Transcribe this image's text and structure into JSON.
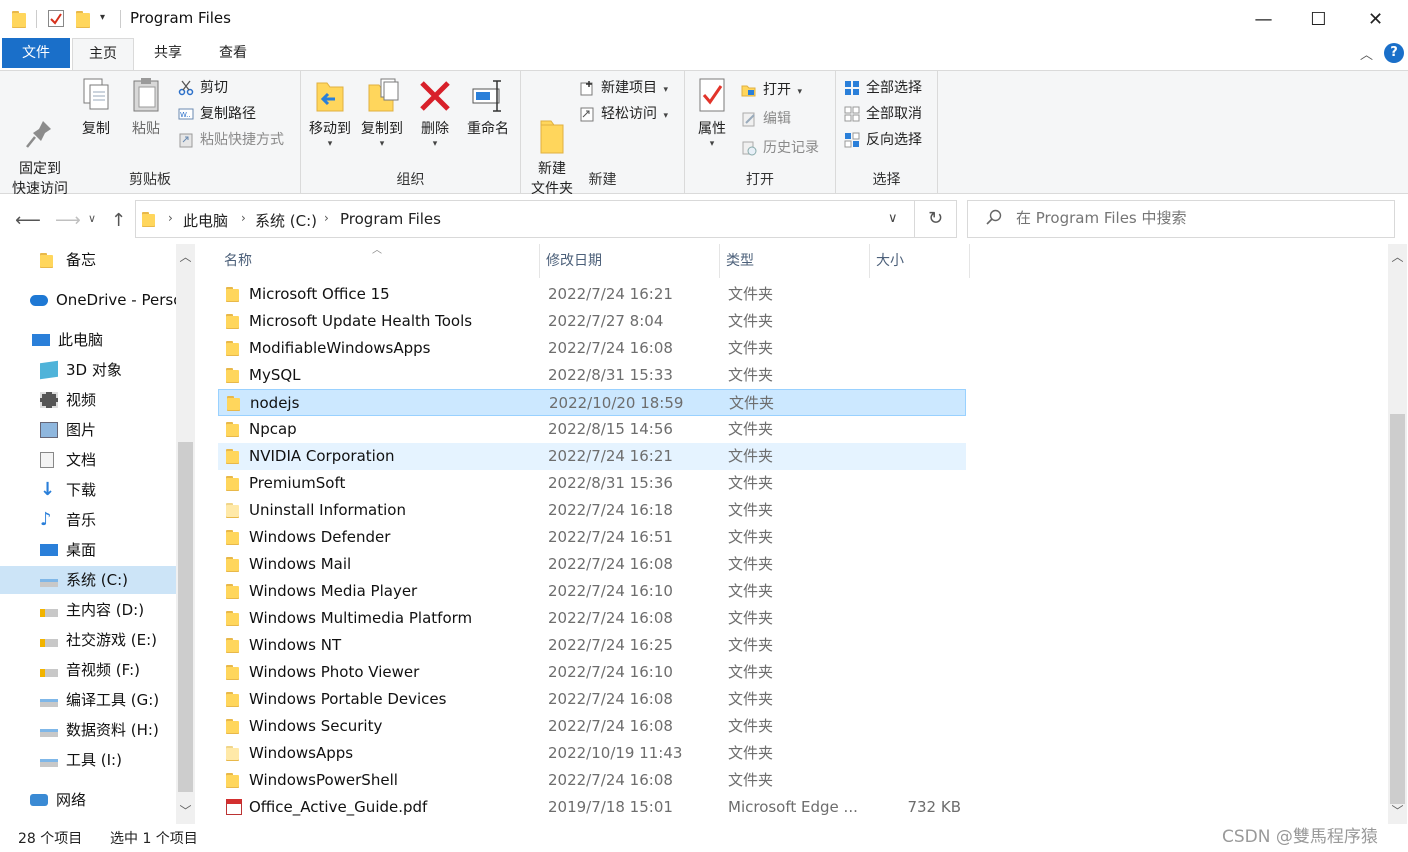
{
  "window": {
    "title": "Program Files",
    "controls": {
      "minimize": "—",
      "maximize": "☐",
      "close": "✕"
    }
  },
  "ribbon_tabs": [
    "文件",
    "主页",
    "共享",
    "查看"
  ],
  "ribbon": {
    "clipboard": {
      "label": "剪贴板",
      "pin": "固定到\n快速访问",
      "copy": "复制",
      "paste": "粘贴",
      "cut": "剪切",
      "copy_path": "复制路径",
      "paste_shortcut": "粘贴快捷方式"
    },
    "organize": {
      "label": "组织",
      "move_to": "移动到",
      "copy_to": "复制到",
      "delete": "删除",
      "rename": "重命名"
    },
    "new": {
      "label": "新建",
      "new_folder": "新建\n文件夹",
      "new_item": "新建项目",
      "easy_access": "轻松访问"
    },
    "open": {
      "label": "打开",
      "properties": "属性",
      "open": "打开",
      "edit": "编辑",
      "history": "历史记录"
    },
    "select": {
      "label": "选择",
      "select_all": "全部选择",
      "select_none": "全部取消",
      "invert": "反向选择"
    }
  },
  "address": {
    "crumbs": [
      "此电脑",
      "系统 (C:)",
      "Program Files"
    ],
    "search_placeholder": "在 Program Files 中搜索"
  },
  "nav_items": [
    {
      "label": "备忘",
      "icon": "folder-icon"
    },
    {
      "label": "OneDrive - Personal",
      "icon": "onedrive-icon"
    },
    {
      "label": "此电脑",
      "icon": "computer-icon"
    },
    {
      "label": "3D 对象",
      "icon": "3d-objects-icon"
    },
    {
      "label": "视频",
      "icon": "video-icon"
    },
    {
      "label": "图片",
      "icon": "pictures-icon"
    },
    {
      "label": "文档",
      "icon": "documents-icon"
    },
    {
      "label": "下载",
      "icon": "download-icon"
    },
    {
      "label": "音乐",
      "icon": "music-icon"
    },
    {
      "label": "桌面",
      "icon": "desktop-icon"
    },
    {
      "label": "系统 (C:)",
      "icon": "drive-icon",
      "selected": true
    },
    {
      "label": "主内容 (D:)",
      "icon": "drive-warning-icon"
    },
    {
      "label": "社交游戏 (E:)",
      "icon": "drive-warning-icon"
    },
    {
      "label": "音视频 (F:)",
      "icon": "drive-warning-icon"
    },
    {
      "label": "编译工具 (G:)",
      "icon": "drive-icon"
    },
    {
      "label": "数据资料 (H:)",
      "icon": "drive-icon"
    },
    {
      "label": "工具 (I:)",
      "icon": "drive-icon"
    },
    {
      "label": "网络",
      "icon": "network-icon"
    }
  ],
  "columns": {
    "name": "名称",
    "date": "修改日期",
    "type": "类型",
    "size": "大小"
  },
  "files": [
    {
      "name": "Microsoft Office 15",
      "date": "2022/7/24 16:21",
      "type": "文件夹",
      "size": ""
    },
    {
      "name": "Microsoft Update Health Tools",
      "date": "2022/7/27 8:04",
      "type": "文件夹",
      "size": ""
    },
    {
      "name": "ModifiableWindowsApps",
      "date": "2022/7/24 16:08",
      "type": "文件夹",
      "size": ""
    },
    {
      "name": "MySQL",
      "date": "2022/8/31 15:33",
      "type": "文件夹",
      "size": ""
    },
    {
      "name": "nodejs",
      "date": "2022/10/20 18:59",
      "type": "文件夹",
      "size": "",
      "state": "selected"
    },
    {
      "name": "Npcap",
      "date": "2022/8/15 14:56",
      "type": "文件夹",
      "size": ""
    },
    {
      "name": "NVIDIA Corporation",
      "date": "2022/7/24 16:21",
      "type": "文件夹",
      "size": "",
      "state": "hover"
    },
    {
      "name": "PremiumSoft",
      "date": "2022/8/31 15:36",
      "type": "文件夹",
      "size": ""
    },
    {
      "name": "Uninstall Information",
      "date": "2022/7/24 16:18",
      "type": "文件夹",
      "size": "",
      "light": true
    },
    {
      "name": "Windows Defender",
      "date": "2022/7/24 16:51",
      "type": "文件夹",
      "size": ""
    },
    {
      "name": "Windows Mail",
      "date": "2022/7/24 16:08",
      "type": "文件夹",
      "size": ""
    },
    {
      "name": "Windows Media Player",
      "date": "2022/7/24 16:10",
      "type": "文件夹",
      "size": ""
    },
    {
      "name": "Windows Multimedia Platform",
      "date": "2022/7/24 16:08",
      "type": "文件夹",
      "size": ""
    },
    {
      "name": "Windows NT",
      "date": "2022/7/24 16:25",
      "type": "文件夹",
      "size": ""
    },
    {
      "name": "Windows Photo Viewer",
      "date": "2022/7/24 16:10",
      "type": "文件夹",
      "size": ""
    },
    {
      "name": "Windows Portable Devices",
      "date": "2022/7/24 16:08",
      "type": "文件夹",
      "size": ""
    },
    {
      "name": "Windows Security",
      "date": "2022/7/24 16:08",
      "type": "文件夹",
      "size": ""
    },
    {
      "name": "WindowsApps",
      "date": "2022/10/19 11:43",
      "type": "文件夹",
      "size": "",
      "light": true
    },
    {
      "name": "WindowsPowerShell",
      "date": "2022/7/24 16:08",
      "type": "文件夹",
      "size": ""
    },
    {
      "name": "Office_Active_Guide.pdf",
      "date": "2019/7/18 15:01",
      "type": "Microsoft Edge ...",
      "size": "732 KB",
      "pdf": true
    }
  ],
  "status": {
    "count": "28 个项目",
    "selected": "选中 1 个项目"
  },
  "watermark": "CSDN @雙馬程序猿",
  "colors": {
    "accent": "#1a6fc9",
    "selection": "#cce8ff",
    "hover": "#e5f3ff",
    "folder": "#ffd65c"
  }
}
